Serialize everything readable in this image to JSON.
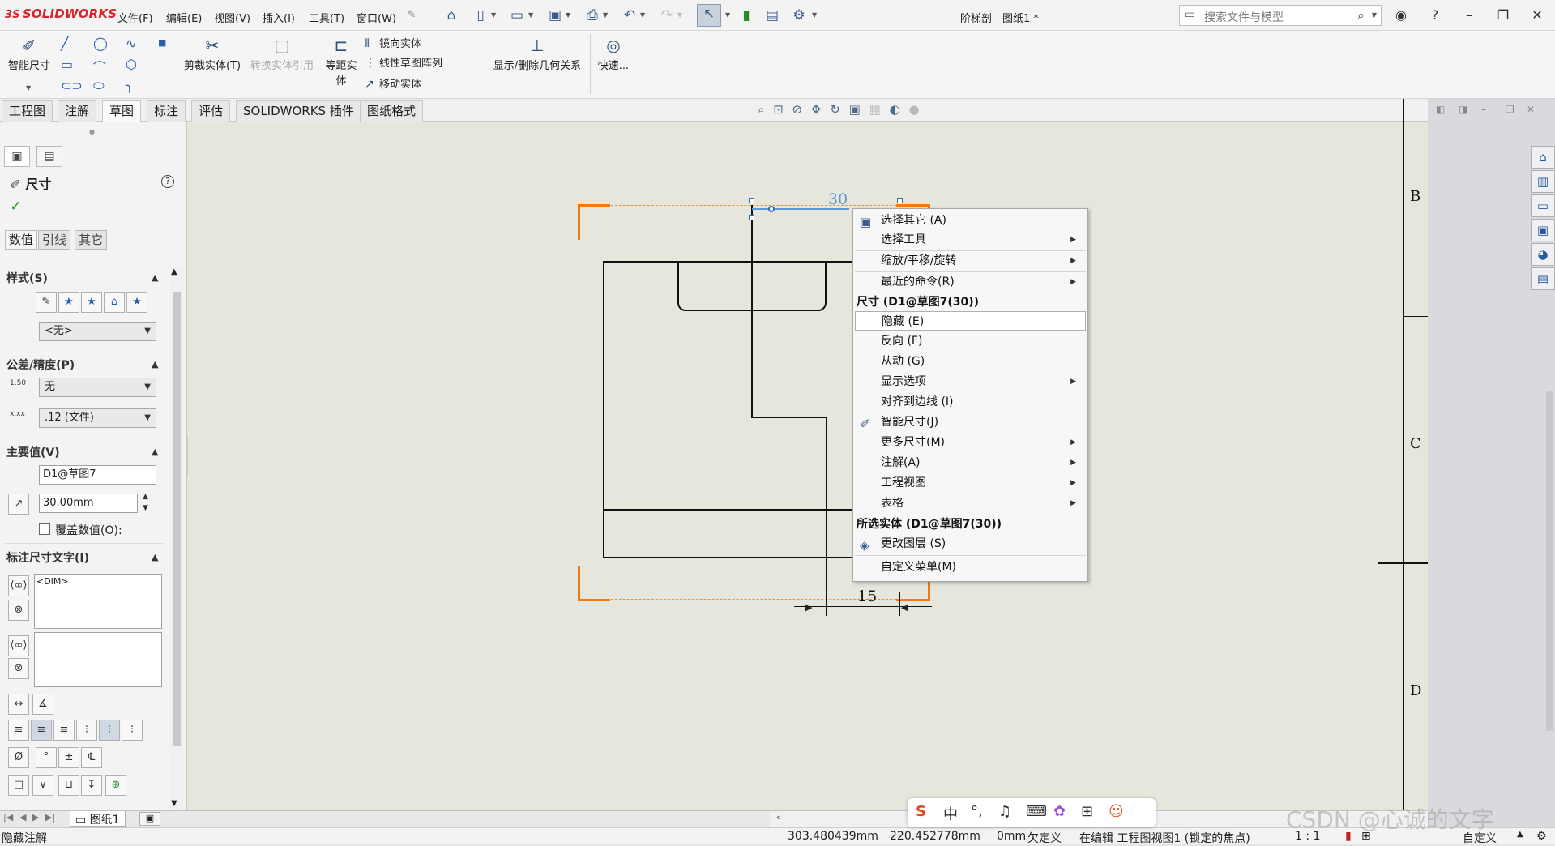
{
  "app": {
    "logo_text": "SOLIDWORKS",
    "logo_prefix": "3S",
    "doc_title": "阶梯剖 - 图纸1 *"
  },
  "menu": [
    "文件(F)",
    "编辑(E)",
    "视图(V)",
    "插入(I)",
    "工具(T)",
    "窗口(W)"
  ],
  "search": {
    "placeholder": "搜索文件与模型"
  },
  "ribbon": {
    "smart_dim": "智能尺寸",
    "trim": "剪裁实体(T)",
    "convert": "转换实体引用",
    "offset": "等距实体",
    "mirror": "镜向实体",
    "linear_pattern": "线性草图阵列",
    "move": "移动实体",
    "relations": "显示/删除几何关系",
    "quick": "快速..."
  },
  "tabs": [
    "工程图",
    "注解",
    "草图",
    "标注",
    "评估",
    "SOLIDWORKS 插件",
    "图纸格式"
  ],
  "active_tab": "草图",
  "property_manager": {
    "title": "尺寸",
    "subtabs": [
      "数值",
      "引线",
      "其它"
    ],
    "style_group": "样式(S)",
    "style_value": "<无>",
    "tolerance_group": "公差/精度(P)",
    "tolerance_value": "无",
    "precision_value": ".12 (文件)",
    "primary_group": "主要值(V)",
    "primary_name": "D1@草图7",
    "primary_value": "30.00mm",
    "override_label": "覆盖数值(O):",
    "dimtext_group": "标注尺寸文字(I)",
    "dim_text": "<DIM>"
  },
  "drawing": {
    "dim_top": "30",
    "dim_bottom": "15",
    "zones": [
      "B",
      "C",
      "D"
    ]
  },
  "context_menu": {
    "items_top": [
      {
        "label": "选择其它 (A)",
        "arrow": false
      },
      {
        "label": "选择工具",
        "arrow": true
      },
      {
        "label": "缩放/平移/旋转",
        "arrow": true
      },
      {
        "label": "最近的命令(R)",
        "arrow": true
      }
    ],
    "header_dim": "尺寸 (D1@草图7(30))",
    "items_dim": [
      {
        "label": "隐藏 (E)",
        "arrow": false
      },
      {
        "label": "反向 (F)",
        "arrow": false
      },
      {
        "label": "从动 (G)",
        "arrow": false
      },
      {
        "label": "显示选项",
        "arrow": true
      },
      {
        "label": "对齐到边线 (I)",
        "arrow": false
      },
      {
        "label": "智能尺寸(J)",
        "arrow": false
      },
      {
        "label": "更多尺寸(M)",
        "arrow": true
      },
      {
        "label": "注解(A)",
        "arrow": true
      },
      {
        "label": "工程视图",
        "arrow": true
      },
      {
        "label": "表格",
        "arrow": true
      }
    ],
    "header_entity": "所选实体 (D1@草图7(30))",
    "items_entity": [
      {
        "label": "更改图层 (S)",
        "arrow": false
      }
    ],
    "customize": "自定义菜单(M)"
  },
  "sheet_tab": "图纸1",
  "status": {
    "left": "隐藏注解",
    "x": "303.480439mm",
    "y": "220.452778mm",
    "z": "0mm",
    "defined": "欠定义",
    "editing": "在编辑 工程图视图1 (锁定的焦点)",
    "scale": "1 : 1",
    "custom": "自定义"
  },
  "ime": {
    "lang": "中"
  },
  "watermark": "CSDN @心诚的文字"
}
